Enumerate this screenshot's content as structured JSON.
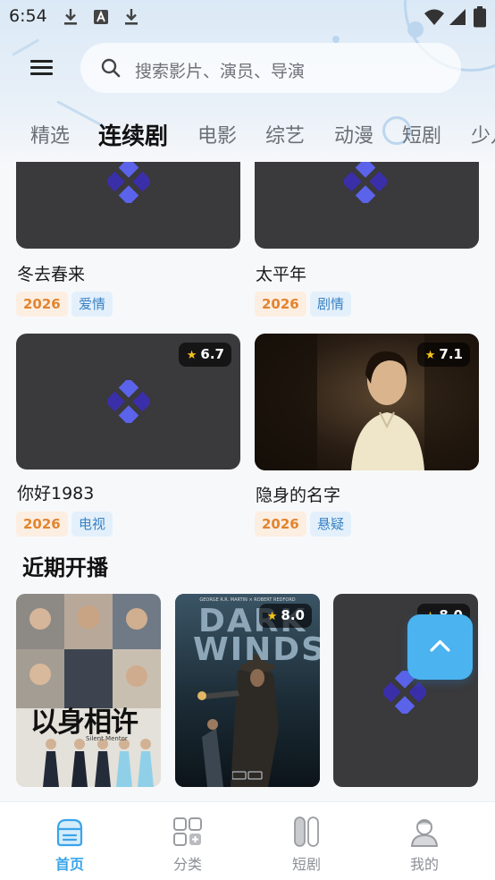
{
  "status_bar": {
    "time": "6:54"
  },
  "header": {
    "search_placeholder": "搜索影片、演员、导演"
  },
  "tabs": [
    "精选",
    "连续剧",
    "电影",
    "综艺",
    "动漫",
    "短剧",
    "少儿"
  ],
  "active_tab": "连续剧",
  "series_grid": [
    {
      "title": "冬去春来",
      "year": "2026",
      "genre": "爱情",
      "rating": ""
    },
    {
      "title": "太平年",
      "year": "2026",
      "genre": "剧情",
      "rating": ""
    },
    {
      "title": "你好1983",
      "year": "2026",
      "genre": "电视",
      "rating": "6.7"
    },
    {
      "title": "隐身的名字",
      "year": "2026",
      "genre": "悬疑",
      "rating": "7.1"
    }
  ],
  "upcoming": {
    "section_title": "近期开播",
    "items": [
      {
        "poster_text": "以身相许",
        "poster_subtext": "Silent Mentor",
        "rating": ""
      },
      {
        "poster_text_line1": "DARK",
        "poster_text_line2": "WINDS",
        "poster_credit": "GEORGE R.R. MARTIN × ROBERT REDFORD",
        "rating": "8.0"
      },
      {
        "rating": "8.0"
      }
    ]
  },
  "bottom_nav": [
    {
      "label": "首页",
      "icon": "home-icon",
      "active": true
    },
    {
      "label": "分类",
      "icon": "category-icon",
      "active": false
    },
    {
      "label": "短剧",
      "icon": "short-drama-icon",
      "active": false
    },
    {
      "label": "我的",
      "icon": "profile-icon",
      "active": false
    }
  ],
  "colors": {
    "accent": "#3aa4ea",
    "fab": "#4ab3f0",
    "year_tag": "#e2842e",
    "genre_tag": "#3b82c4",
    "placeholder_bg": "#3a393b"
  }
}
